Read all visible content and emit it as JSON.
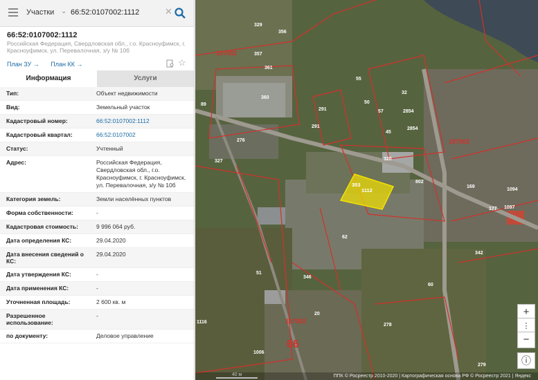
{
  "search": {
    "category": "Участки",
    "query": "66:52:0107002:1112"
  },
  "object": {
    "title": "66:52:0107002:1112",
    "subtitle": "Российская Федерация, Свердловская обл., г.о. Красноуфимск, г. Красноуфимск, ул. Перевалочная, з/у № 10б",
    "plan_zu": "План ЗУ →",
    "plan_kk": "План КК →"
  },
  "tabs": [
    "Информация",
    "Услуги"
  ],
  "properties": [
    {
      "k": "Тип:",
      "v": "Объект недвижимости"
    },
    {
      "k": "Вид:",
      "v": "Земельный участок"
    },
    {
      "k": "Кадастровый номер:",
      "v": "66:52:0107002:1112"
    },
    {
      "k": "Кадастровый квартал:",
      "v": "66:52:0107002"
    },
    {
      "k": "Статус:",
      "v": "Учтенный"
    },
    {
      "k": "Адрес:",
      "v": "Российская Федерация, Свердловская обл., г.о. Красноуфимск, г. Красноуфимск, ул. Перевалочная, з/у № 10б"
    },
    {
      "k": "Категория земель:",
      "v": "Земли населённых пунктов"
    },
    {
      "k": "Форма собственности:",
      "v": "-"
    },
    {
      "k": "Кадастровая стоимость:",
      "v": "9 996 064 руб."
    },
    {
      "k": "Дата определения КС:",
      "v": "29.04.2020"
    },
    {
      "k": "Дата внесения сведений о КС:",
      "v": "29.04.2020"
    },
    {
      "k": "Дата утверждения КС:",
      "v": "-"
    },
    {
      "k": "Дата применения КС:",
      "v": "-"
    },
    {
      "k": "Уточненная площадь:",
      "v": "2 600 кв. м"
    },
    {
      "k": "Разрешенное использование:",
      "v": "-"
    },
    {
      "k": "по документу:",
      "v": "Деловое управление"
    }
  ],
  "map": {
    "labels": [
      "356",
      "329",
      "357",
      "361",
      "360",
      "291",
      "291",
      "276",
      "327",
      "1112",
      "353",
      "320",
      "802",
      "2854",
      "2854",
      "107002",
      "107002",
      "107002",
      "66",
      "62",
      "51",
      "346",
      "20",
      "278",
      "279",
      "1116",
      "1006",
      "89",
      "45",
      "57",
      "50",
      "55",
      "32",
      "169",
      "1094",
      "1097",
      "177",
      "342",
      "60"
    ],
    "scale": "40 м",
    "attribution": "ППК © Росреестр 2010-2020 | Картографическая основа РФ © Росреестр 2021 | Яндекс",
    "zoom_in": "+",
    "zoom_out": "−",
    "more": "⋮",
    "info": "ⓘ"
  }
}
